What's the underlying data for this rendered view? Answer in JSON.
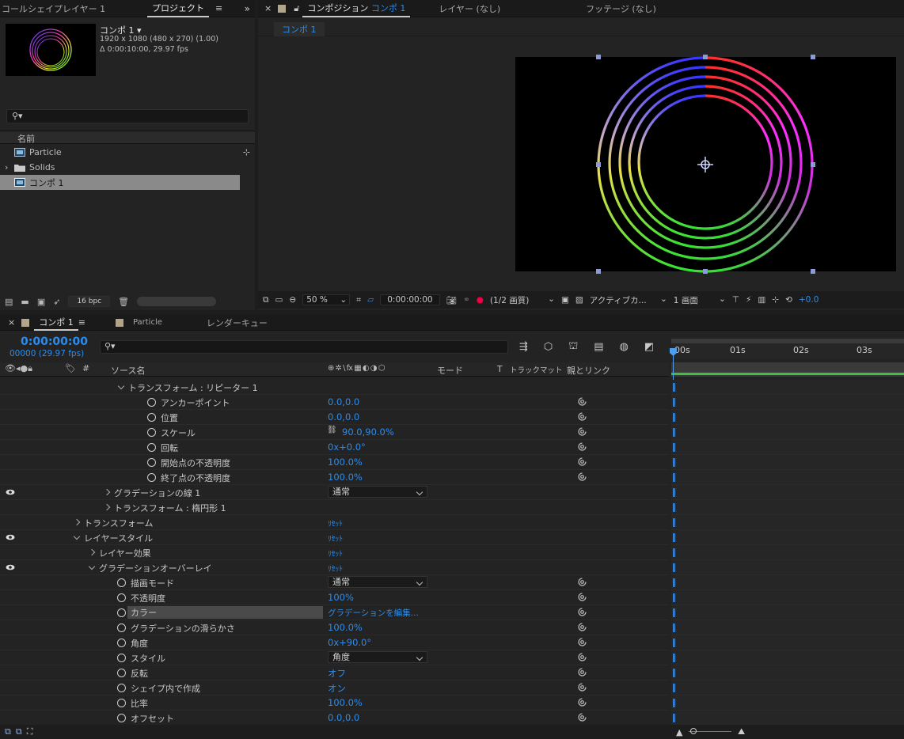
{
  "project_panel": {
    "tabs": [
      "コールシェイプレイヤー 1",
      "プロジェクト"
    ],
    "comp_name": "コンポ 1 ▾",
    "comp_info1": "1920 x 1080  (480 x 270) (1.00)",
    "comp_info2": "Δ 0:00:10:00, 29.97 fps",
    "search_placeholder": "",
    "col_name": "名前",
    "items": [
      {
        "label": "Particle",
        "type": "comp"
      },
      {
        "label": "Solids",
        "type": "folder"
      },
      {
        "label": "コンポ 1",
        "type": "comp"
      }
    ],
    "bpc": "16 bpc"
  },
  "viewer": {
    "tabs": [
      "コンポジション コンポ 1",
      "レイヤー (なし)",
      "フッテージ (なし)"
    ],
    "comp_tab_prefix": "コンポジション",
    "comp_tab_name": "コンポ 1",
    "breadcrumb": "コンポ 1",
    "toolbar": {
      "zoom": "50 %",
      "timecode": "0:00:00:00",
      "resolution": "(1/2 画質)",
      "camera": "アクティブカ...",
      "views": "1 画面",
      "exposure": "+0.0"
    }
  },
  "timeline": {
    "tabs": [
      "コンポ 1",
      "Particle",
      "レンダーキュー"
    ],
    "timecode": "0:00:00:00",
    "frames": "00000 (29.97 fps)",
    "columns": {
      "source_name": "ソース名",
      "mode": "モード",
      "t": "T",
      "trackmatte": "トラックマット",
      "parent": "親とリンク",
      "switches": "⊕ ✲ \\ fx ▦ ◐ ◑ ⬡"
    },
    "ruler": [
      "00s",
      "01s",
      "02s",
      "03s"
    ],
    "rows": [
      {
        "name": "トランスフォーム : リピーター 1",
        "indent": 150,
        "twirl": "open"
      },
      {
        "name": "アンカーポイント",
        "indent": 186,
        "stopwatch": true,
        "value": "0.0,0.0",
        "pickwhip": true
      },
      {
        "name": "位置",
        "indent": 186,
        "stopwatch": true,
        "value": "0.0,0.0",
        "pickwhip": true
      },
      {
        "name": "スケール",
        "indent": 186,
        "stopwatch": true,
        "value": "90.0,90.0%",
        "link": true,
        "pickwhip": true
      },
      {
        "name": "回転",
        "indent": 186,
        "stopwatch": true,
        "value": "0x+0.0°",
        "pickwhip": true
      },
      {
        "name": "開始点の不透明度",
        "indent": 186,
        "stopwatch": true,
        "value": "100.0%",
        "pickwhip": true
      },
      {
        "name": "終了点の不透明度",
        "indent": 186,
        "stopwatch": true,
        "value": "100.0%",
        "pickwhip": true
      },
      {
        "name": "グラデーションの線 1",
        "indent": 132,
        "twirl": "closed",
        "eye": true,
        "dropdown": "通常"
      },
      {
        "name": "トランスフォーム : 楕円形 1",
        "indent": 132,
        "twirl": "closed"
      },
      {
        "name": "トランスフォーム",
        "indent": 94,
        "twirl": "closed",
        "reset": "ﾘｾｯﾄ"
      },
      {
        "name": "レイヤースタイル",
        "indent": 94,
        "twirl": "open",
        "eye": true,
        "reset": "ﾘｾｯﾄ"
      },
      {
        "name": "レイヤー効果",
        "indent": 113,
        "twirl": "closed",
        "reset": "ﾘｾｯﾄ"
      },
      {
        "name": "グラデーションオーバーレイ",
        "indent": 113,
        "twirl": "open",
        "eye": true,
        "reset": "ﾘｾｯﾄ"
      },
      {
        "name": "描画モード",
        "indent": 148,
        "stopwatch": true,
        "dropdown": "通常",
        "pickwhip": true
      },
      {
        "name": "不透明度",
        "indent": 148,
        "stopwatch": true,
        "value": "100%",
        "pickwhip": true
      },
      {
        "name": "カラー",
        "indent": 148,
        "stopwatch": true,
        "value": "グラデーションを編集...",
        "selected": true,
        "pickwhip": true
      },
      {
        "name": "グラデーションの滑らかさ",
        "indent": 148,
        "stopwatch": true,
        "value": "100.0%",
        "pickwhip": true
      },
      {
        "name": "角度",
        "indent": 148,
        "stopwatch": true,
        "value": "0x+90.0°",
        "pickwhip": true
      },
      {
        "name": "スタイル",
        "indent": 148,
        "stopwatch": true,
        "dropdown": "角度",
        "pickwhip": true
      },
      {
        "name": "反転",
        "indent": 148,
        "stopwatch": true,
        "value": "オフ",
        "pickwhip": true
      },
      {
        "name": "シェイプ内で作成",
        "indent": 148,
        "stopwatch": true,
        "value": "オン",
        "pickwhip": true
      },
      {
        "name": "比率",
        "indent": 148,
        "stopwatch": true,
        "value": "100.0%",
        "pickwhip": true
      },
      {
        "name": "オフセット",
        "indent": 148,
        "stopwatch": true,
        "value": "0.0,0.0",
        "pickwhip": true
      }
    ]
  },
  "colors": {
    "accent": "#2d8ceb",
    "panel": "#232323",
    "green": "#3fbf3f"
  }
}
